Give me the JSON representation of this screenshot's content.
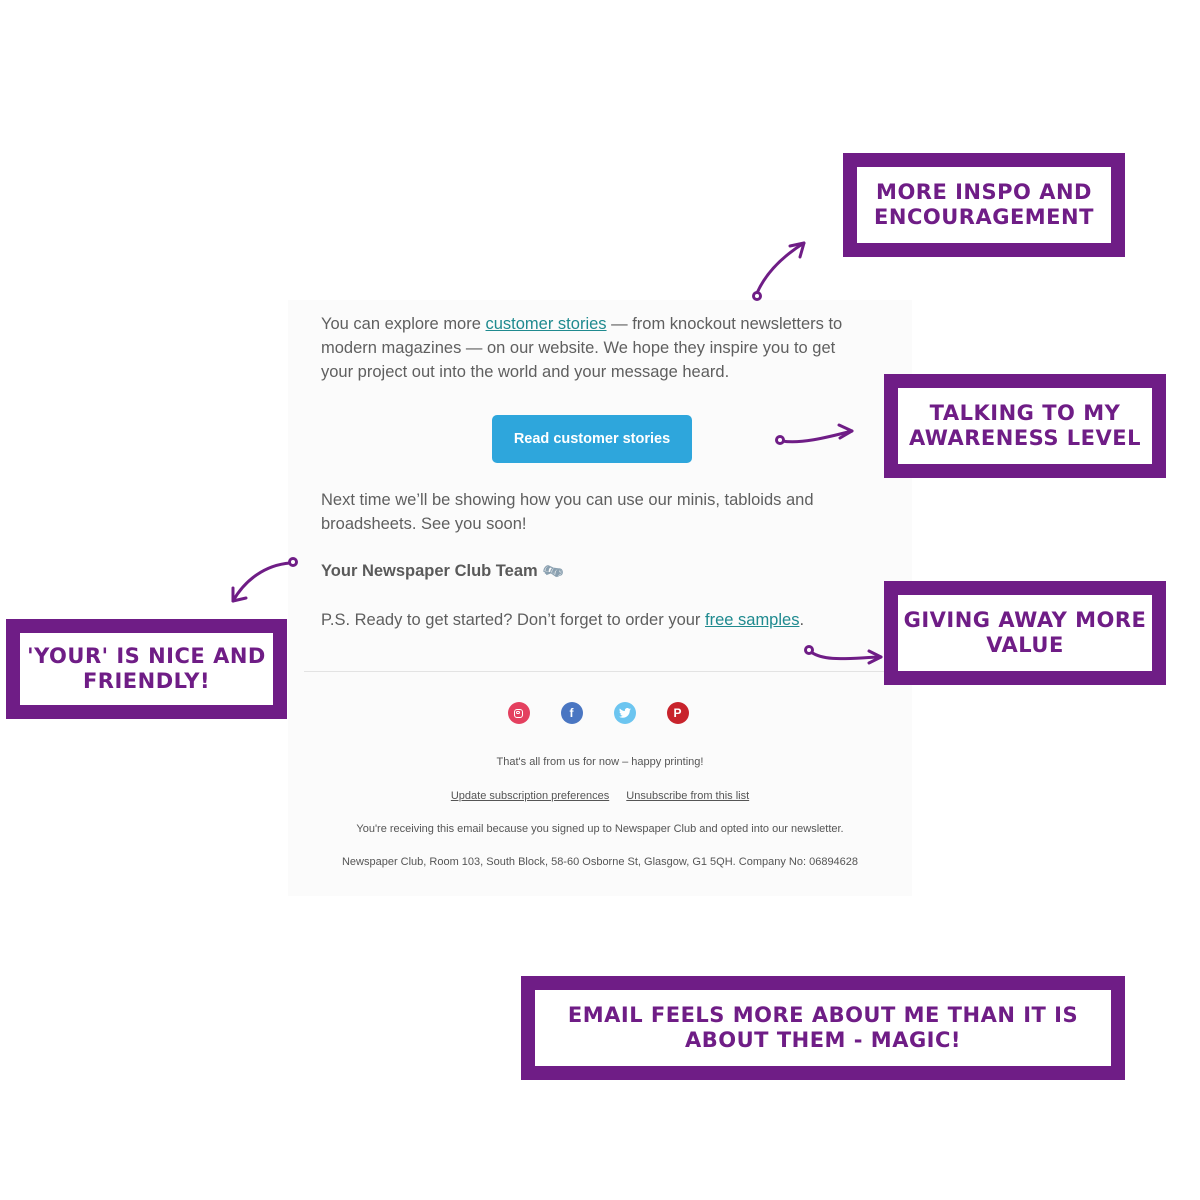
{
  "email": {
    "paragraph1": {
      "before": "You can explore more ",
      "link": "customer stories",
      "after": " — from knockout newsletters to modern magazines — on our website. We hope they inspire you to get your project out into the world and your message heard."
    },
    "cta_label": "Read customer stories",
    "paragraph2": "Next time we’ll be showing how you can use our minis, tabloids and broadsheets. See you soon!",
    "signature": "Your Newspaper Club Team",
    "signature_icon": "newspaper-roll-icon",
    "ps": {
      "before": "P.S. Ready to get started? Don’t forget to order your ",
      "link": "free samples",
      "after": "."
    },
    "social": [
      {
        "name": "instagram",
        "icon": "instagram-icon",
        "color": "#e4405f"
      },
      {
        "name": "facebook",
        "icon": "facebook-icon",
        "glyph": "f",
        "color": "#4a76c2"
      },
      {
        "name": "twitter",
        "icon": "twitter-icon",
        "glyph": "🐦",
        "color": "#6cc5f0"
      },
      {
        "name": "pinterest",
        "icon": "pinterest-icon",
        "glyph": "P",
        "color": "#c8232c"
      }
    ],
    "footer": {
      "signoff": "That's all from us for now – happy printing!",
      "update_prefs": "Update subscription preferences",
      "unsubscribe": "Unsubscribe from this list",
      "reason": "You're receiving this email because you signed up to Newspaper Club and opted into our newsletter.",
      "address": "Newspaper Club, Room 103, South Block, 58-60 Osborne St, Glasgow, G1 5QH. Company No: 06894628"
    }
  },
  "annotations": {
    "inspo": "More inspo and encouragement",
    "awareness": "Talking to my awareness level",
    "value": "Giving away more value",
    "your": "'Your' is nice and friendly!",
    "magic": "Email feels more about me than it is about them - magic!"
  },
  "colors": {
    "accent_purple": "#6f1d86",
    "cta_blue": "#2ea6dc",
    "link_teal": "#1f8a8f"
  }
}
